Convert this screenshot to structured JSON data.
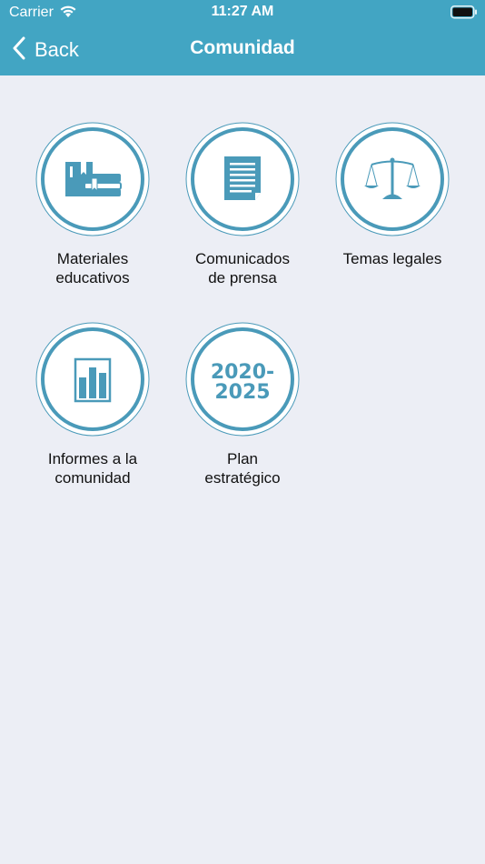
{
  "status_bar": {
    "carrier": "Carrier",
    "time": "11:27 AM",
    "wifi_icon": "wifi-icon",
    "battery_icon": "battery-icon"
  },
  "nav": {
    "back_label": "Back",
    "title": "Comunidad"
  },
  "colors": {
    "header_bg": "#42a5c3",
    "accent": "#4a9ab9",
    "background": "#eceef5"
  },
  "tiles": [
    {
      "icon": "books-icon",
      "label_line1": "Materiales",
      "label_line2": "educativos"
    },
    {
      "icon": "document-icon",
      "label_line1": "Comunicados",
      "label_line2": "de prensa"
    },
    {
      "icon": "scales-icon",
      "label_line1": "Temas legales",
      "label_line2": ""
    },
    {
      "icon": "bar-chart-icon",
      "label_line1": "Informes a la",
      "label_line2": "comunidad"
    },
    {
      "icon": "calendar-years-icon",
      "year_line1": "2020-",
      "year_line2": "2025",
      "label_line1": "Plan",
      "label_line2": "estratégico"
    }
  ]
}
